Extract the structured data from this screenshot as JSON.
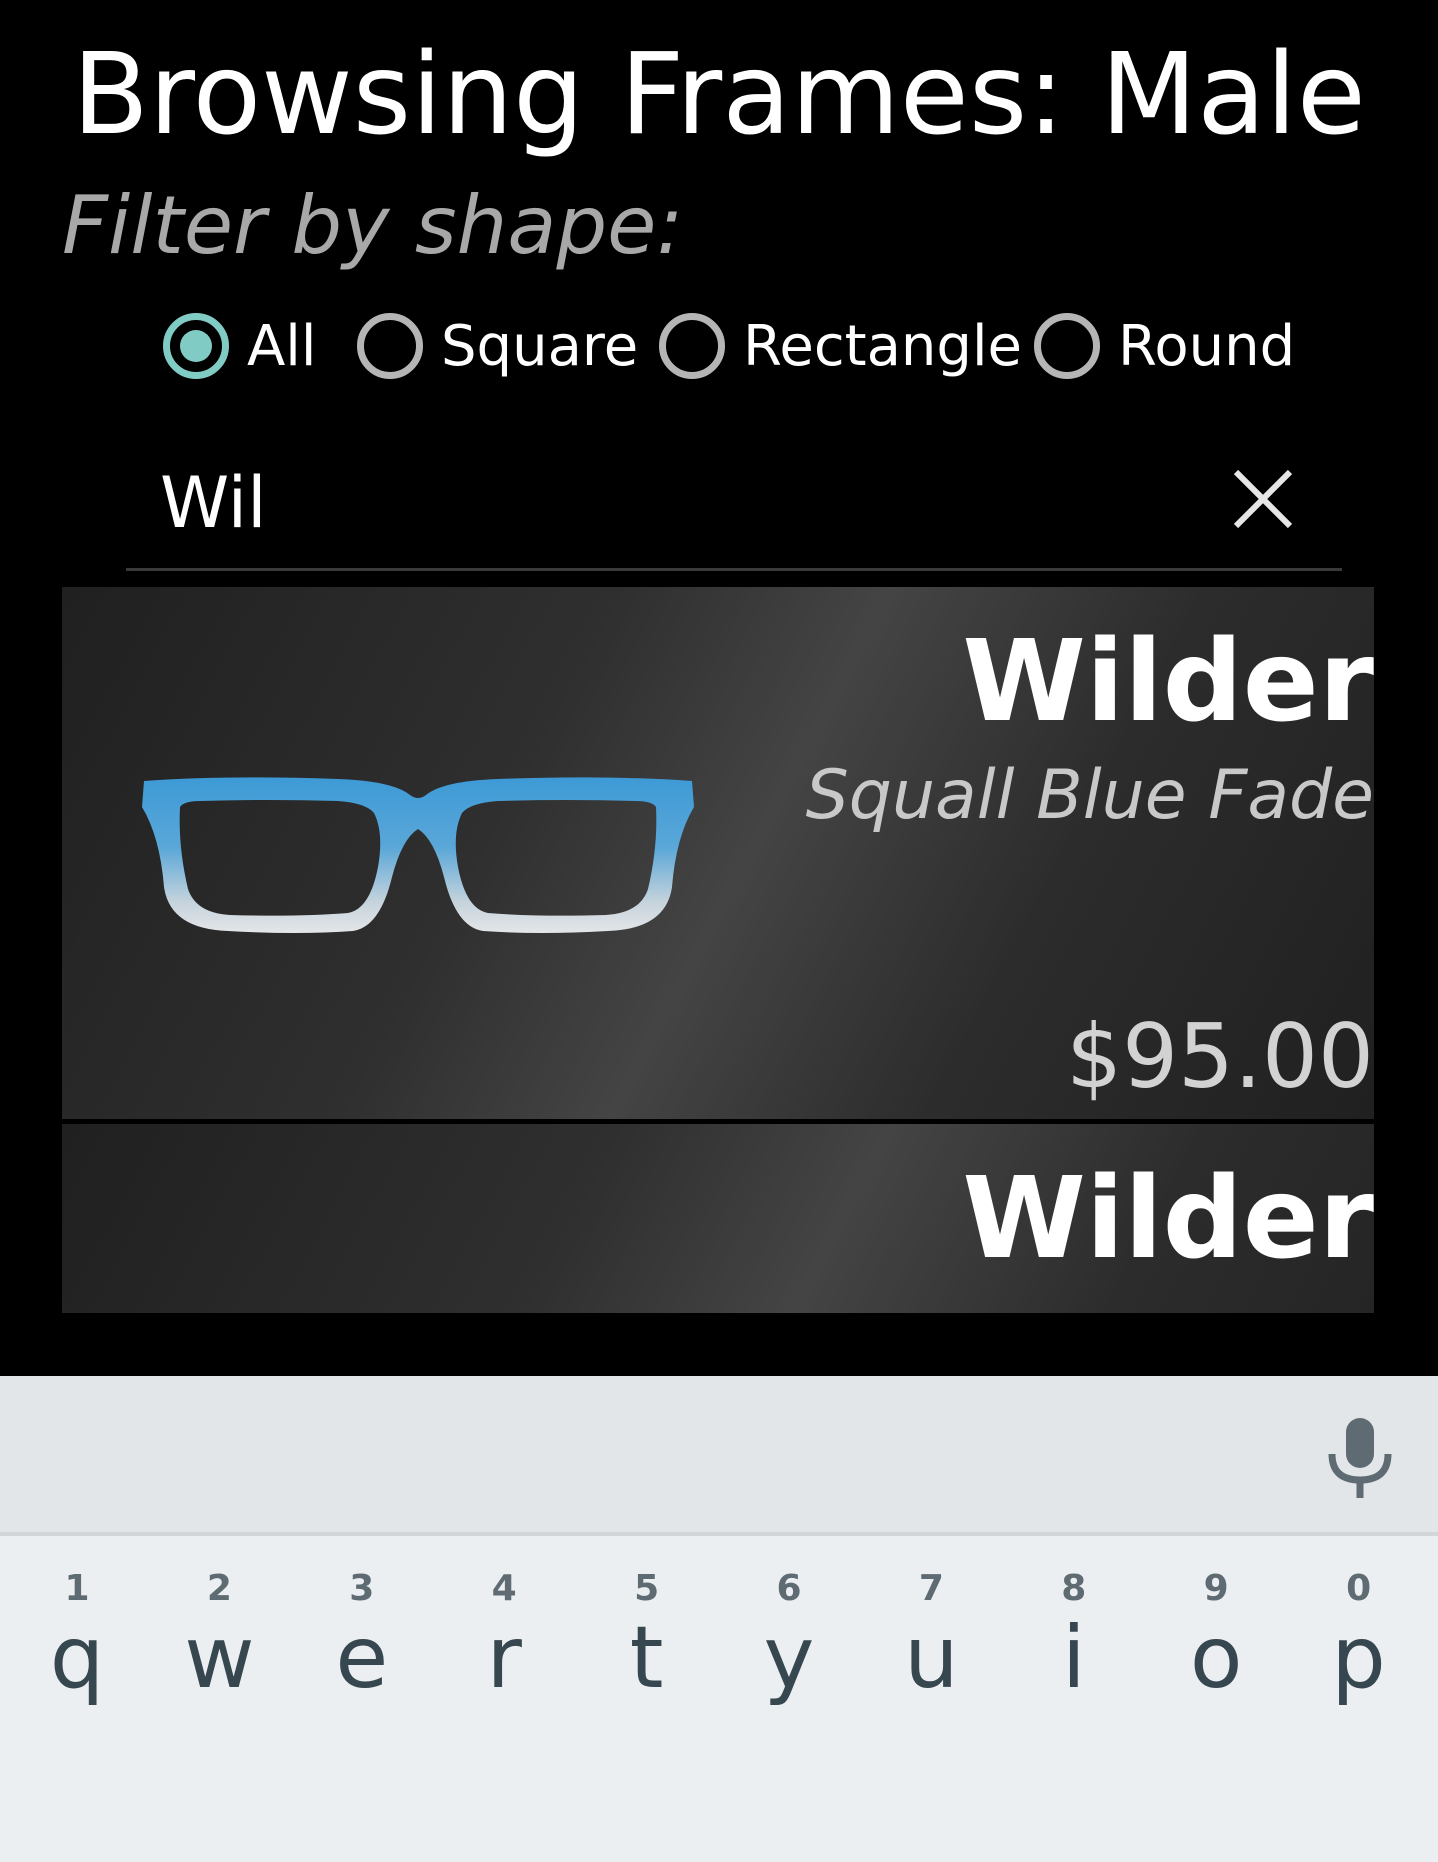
{
  "header": {
    "title": "Browsing Frames: Male"
  },
  "filter": {
    "label": "Filter by shape:",
    "options": [
      {
        "label": "All",
        "checked": true
      },
      {
        "label": "Square",
        "checked": false
      },
      {
        "label": "Rectangle",
        "checked": false
      },
      {
        "label": "Round",
        "checked": false
      }
    ],
    "accent_color": "#80cbc4"
  },
  "search": {
    "value": "Wil",
    "clear_icon": "close-icon"
  },
  "results": [
    {
      "name": "Wilder",
      "color": "Squall Blue Fade",
      "price": "$95.00",
      "image_icon": "eyeglasses-icon"
    },
    {
      "name": "Wilder",
      "color": "",
      "price": ""
    }
  ],
  "keyboard": {
    "mic_icon": "microphone-icon",
    "row1": [
      {
        "key": "q",
        "hint": "1"
      },
      {
        "key": "w",
        "hint": "2"
      },
      {
        "key": "e",
        "hint": "3"
      },
      {
        "key": "r",
        "hint": "4"
      },
      {
        "key": "t",
        "hint": "5"
      },
      {
        "key": "y",
        "hint": "6"
      },
      {
        "key": "u",
        "hint": "7"
      },
      {
        "key": "i",
        "hint": "8"
      },
      {
        "key": "o",
        "hint": "9"
      },
      {
        "key": "p",
        "hint": "0"
      }
    ]
  }
}
